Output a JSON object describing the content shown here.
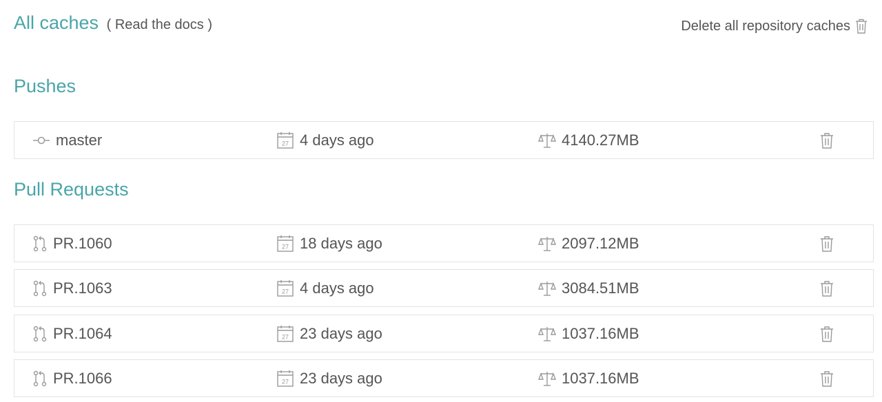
{
  "header": {
    "title": "All caches",
    "docs_open": "(",
    "docs_link": "Read the docs",
    "docs_close": ")",
    "delete_all_label": "Delete all repository caches"
  },
  "sections": [
    {
      "title": "Pushes",
      "rows": [
        {
          "name": "master",
          "name_icon": "commit-icon",
          "date": "4 days ago",
          "size": "4140.27MB"
        }
      ]
    },
    {
      "title": "Pull Requests",
      "rows": [
        {
          "name": "PR.1060",
          "name_icon": "pull-request-icon",
          "date": "18 days ago",
          "size": "2097.12MB"
        },
        {
          "name": "PR.1063",
          "name_icon": "pull-request-icon",
          "date": "4 days ago",
          "size": "3084.51MB"
        },
        {
          "name": "PR.1064",
          "name_icon": "pull-request-icon",
          "date": "23 days ago",
          "size": "1037.16MB"
        },
        {
          "name": "PR.1066",
          "name_icon": "pull-request-icon",
          "date": "23 days ago",
          "size": "1037.16MB"
        }
      ]
    }
  ],
  "icons": {
    "calendar_day": "27",
    "date_icon": "calendar-icon",
    "size_icon": "scale-icon",
    "delete_icon": "trash-icon"
  },
  "colors": {
    "accent": "#4aa5a8",
    "text": "#555555",
    "icon": "#9a9a9a",
    "border": "#e3e3e3"
  }
}
